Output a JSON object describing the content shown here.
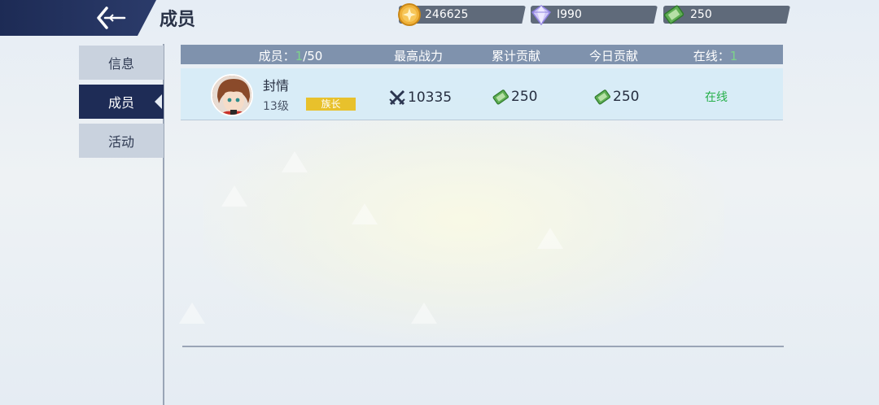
{
  "header": {
    "title": "成员"
  },
  "resources": [
    {
      "icon": "gold-coin-icon",
      "value": "246625"
    },
    {
      "icon": "diamond-icon",
      "value": "I990"
    },
    {
      "icon": "green-ticket-icon",
      "value": "250"
    }
  ],
  "sidebar": {
    "tabs": [
      {
        "label": "信息",
        "active": false
      },
      {
        "label": "成员",
        "active": true
      },
      {
        "label": "活动",
        "active": false
      }
    ]
  },
  "table": {
    "headers": {
      "members_label": "成员：",
      "members_current": "1",
      "members_max": "/50",
      "max_power": "最高战力",
      "total_contribution": "累计贡献",
      "today_contribution": "今日贡献",
      "online_label": "在线：",
      "online_count": "1"
    },
    "rows": [
      {
        "name": "封情",
        "level": "13级",
        "role": "族长",
        "power": "10335",
        "total_contribution": "250",
        "today_contribution": "250",
        "status": "在线"
      }
    ]
  },
  "colors": {
    "accent_navy": "#1e2c56",
    "online_green": "#27b04b",
    "role_badge": "#e8c12c"
  }
}
